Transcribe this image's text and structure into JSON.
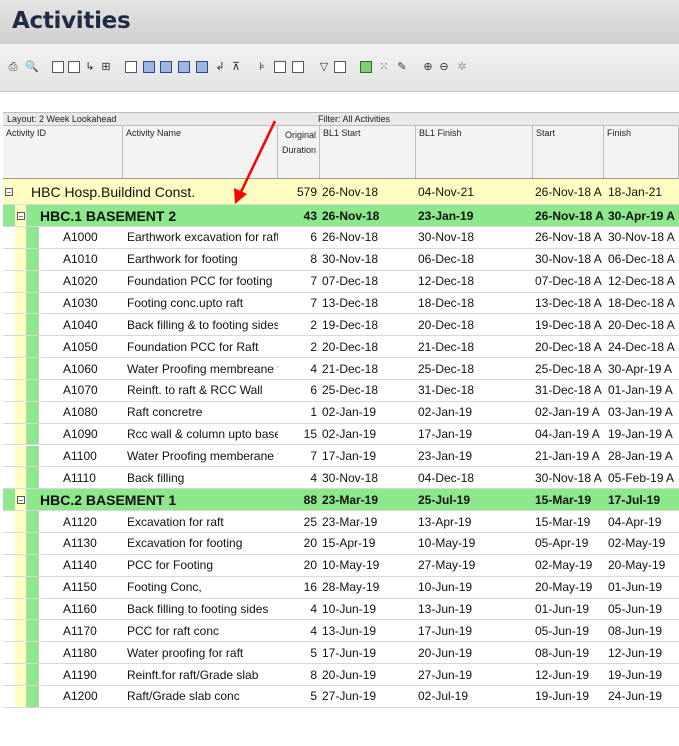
{
  "window": {
    "title": "Activities"
  },
  "toolbar": {
    "icons": [
      "print-icon",
      "print-preview-icon",
      "columns-icon",
      "table-icon",
      "relationship-icon",
      "hierarchy-icon",
      "bars-icon",
      "details-icon",
      "gantt-icon",
      "resource-icon",
      "chart-icon",
      "progress-icon",
      "trace-icon",
      "layout-icon",
      "filter-icon",
      "group-icon",
      "sort-icon",
      "funnel-icon",
      "view-icon",
      "schedule-icon",
      "level-icon",
      "wand-icon",
      "zoom-in-icon",
      "zoom-out-icon",
      "fit-icon"
    ]
  },
  "layout_bar": {
    "layout": "Layout: 2 Week Lookahead",
    "filter": "Filter: All Activities"
  },
  "columns": {
    "activity_id": "Activity ID",
    "activity_name": "Activity Name",
    "original_duration_1": "Original",
    "original_duration_2": "Duration",
    "bl1_start": "BL1 Start",
    "bl1_finish": "BL1 Finish",
    "start": "Start",
    "finish": "Finish"
  },
  "rows": [
    {
      "kind": "proj",
      "expander": "−",
      "name": "HBC  Hosp.Buildind Const.",
      "dur": "579",
      "bl1_start": "26-Nov-18",
      "bl1_finish": "04-Nov-21",
      "start": "26-Nov-18 A",
      "finish": "18-Jan-21"
    },
    {
      "kind": "wbs",
      "expander": "−",
      "name": "HBC.1  BASEMENT 2",
      "dur": "43",
      "bl1_start": "26-Nov-18",
      "bl1_finish": "23-Jan-19",
      "start": "26-Nov-18 A",
      "finish": "30-Apr-19 A"
    },
    {
      "kind": "act",
      "id": "A1000",
      "name": "Earthwork excavation for raft",
      "dur": "6",
      "bl1_start": "26-Nov-18",
      "bl1_finish": "30-Nov-18",
      "start": "26-Nov-18 A",
      "finish": "30-Nov-18 A"
    },
    {
      "kind": "act",
      "id": "A1010",
      "name": "Earthwork for footing",
      "dur": "8",
      "bl1_start": "30-Nov-18",
      "bl1_finish": "06-Dec-18",
      "start": "30-Nov-18 A",
      "finish": "06-Dec-18 A"
    },
    {
      "kind": "act",
      "id": "A1020",
      "name": "Foundation PCC for footing",
      "dur": "7",
      "bl1_start": "07-Dec-18",
      "bl1_finish": "12-Dec-18",
      "start": "07-Dec-18 A",
      "finish": "12-Dec-18 A"
    },
    {
      "kind": "act",
      "id": "A1030",
      "name": "Footing conc.upto raft",
      "dur": "7",
      "bl1_start": "13-Dec-18",
      "bl1_finish": "18-Dec-18",
      "start": "13-Dec-18 A",
      "finish": "18-Dec-18 A"
    },
    {
      "kind": "act",
      "id": "A1040",
      "name": "Back filling & to footing sides",
      "dur": "2",
      "bl1_start": "19-Dec-18",
      "bl1_finish": "20-Dec-18",
      "start": "19-Dec-18 A",
      "finish": "20-Dec-18 A"
    },
    {
      "kind": "act",
      "id": "A1050",
      "name": "Foundation PCC for Raft",
      "dur": "2",
      "bl1_start": "20-Dec-18",
      "bl1_finish": "21-Dec-18",
      "start": "20-Dec-18 A",
      "finish": "24-Dec-18 A"
    },
    {
      "kind": "act",
      "id": "A1060",
      "name": "Water Proofing membreane for",
      "dur": "4",
      "bl1_start": "21-Dec-18",
      "bl1_finish": "25-Dec-18",
      "start": "25-Dec-18 A",
      "finish": "30-Apr-19 A"
    },
    {
      "kind": "act",
      "id": "A1070",
      "name": "Reinft. to raft & RCC Wall",
      "dur": "6",
      "bl1_start": "25-Dec-18",
      "bl1_finish": "31-Dec-18",
      "start": "31-Dec-18 A",
      "finish": "01-Jan-19 A"
    },
    {
      "kind": "act",
      "id": "A1080",
      "name": "Raft concretre",
      "dur": "1",
      "bl1_start": "02-Jan-19",
      "bl1_finish": "02-Jan-19",
      "start": "02-Jan-19 A",
      "finish": "03-Jan-19 A"
    },
    {
      "kind": "act",
      "id": "A1090",
      "name": "Rcc wall & column upto basem",
      "dur": "15",
      "bl1_start": "02-Jan-19",
      "bl1_finish": "17-Jan-19",
      "start": "04-Jan-19 A",
      "finish": "19-Jan-19 A"
    },
    {
      "kind": "act",
      "id": "A1100",
      "name": "Water Proofing memberane for",
      "dur": "7",
      "bl1_start": "17-Jan-19",
      "bl1_finish": "23-Jan-19",
      "start": "21-Jan-19 A",
      "finish": "28-Jan-19 A"
    },
    {
      "kind": "act",
      "id": "A1110",
      "name": "Back filling",
      "dur": "4",
      "bl1_start": "30-Nov-18",
      "bl1_finish": "04-Dec-18",
      "start": "30-Nov-18 A",
      "finish": "05-Feb-19 A"
    },
    {
      "kind": "wbs",
      "expander": "−",
      "name": "HBC.2  BASEMENT 1",
      "dur": "88",
      "bl1_start": "23-Mar-19",
      "bl1_finish": "25-Jul-19",
      "start": "15-Mar-19",
      "finish": "17-Jul-19"
    },
    {
      "kind": "act",
      "id": "A1120",
      "name": "Excavation for raft",
      "dur": "25",
      "bl1_start": "23-Mar-19",
      "bl1_finish": "13-Apr-19",
      "start": "15-Mar-19",
      "finish": "04-Apr-19"
    },
    {
      "kind": "act",
      "id": "A1130",
      "name": "Excavation for footing",
      "dur": "20",
      "bl1_start": "15-Apr-19",
      "bl1_finish": "10-May-19",
      "start": "05-Apr-19",
      "finish": "02-May-19"
    },
    {
      "kind": "act",
      "id": "A1140",
      "name": "PCC for Footing",
      "dur": "20",
      "bl1_start": "10-May-19",
      "bl1_finish": "27-May-19",
      "start": "02-May-19",
      "finish": "20-May-19"
    },
    {
      "kind": "act",
      "id": "A1150",
      "name": "Footing Conc,",
      "dur": "16",
      "bl1_start": "28-May-19",
      "bl1_finish": "10-Jun-19",
      "start": "20-May-19",
      "finish": "01-Jun-19"
    },
    {
      "kind": "act",
      "id": "A1160",
      "name": "Back filling to footing sides",
      "dur": "4",
      "bl1_start": "10-Jun-19",
      "bl1_finish": "13-Jun-19",
      "start": "01-Jun-19",
      "finish": "05-Jun-19"
    },
    {
      "kind": "act",
      "id": "A1170",
      "name": "PCC for raft conc",
      "dur": "4",
      "bl1_start": "13-Jun-19",
      "bl1_finish": "17-Jun-19",
      "start": "05-Jun-19",
      "finish": "08-Jun-19"
    },
    {
      "kind": "act",
      "id": "A1180",
      "name": "Water proofing for raft",
      "dur": "5",
      "bl1_start": "17-Jun-19",
      "bl1_finish": "20-Jun-19",
      "start": "08-Jun-19",
      "finish": "12-Jun-19"
    },
    {
      "kind": "act",
      "id": "A1190",
      "name": "Reinft.for raft/Grade slab",
      "dur": "8",
      "bl1_start": "20-Jun-19",
      "bl1_finish": "27-Jun-19",
      "start": "12-Jun-19",
      "finish": "19-Jun-19"
    },
    {
      "kind": "act",
      "id": "A1200",
      "name": "Raft/Grade slab conc",
      "dur": "5",
      "bl1_start": "27-Jun-19",
      "bl1_finish": "02-Jul-19",
      "start": "19-Jun-19",
      "finish": "24-Jun-19"
    }
  ],
  "colors": {
    "project_row": "#fefdc2",
    "wbs_row": "#8ce88a",
    "annotation_arrow": "#ff0000"
  }
}
